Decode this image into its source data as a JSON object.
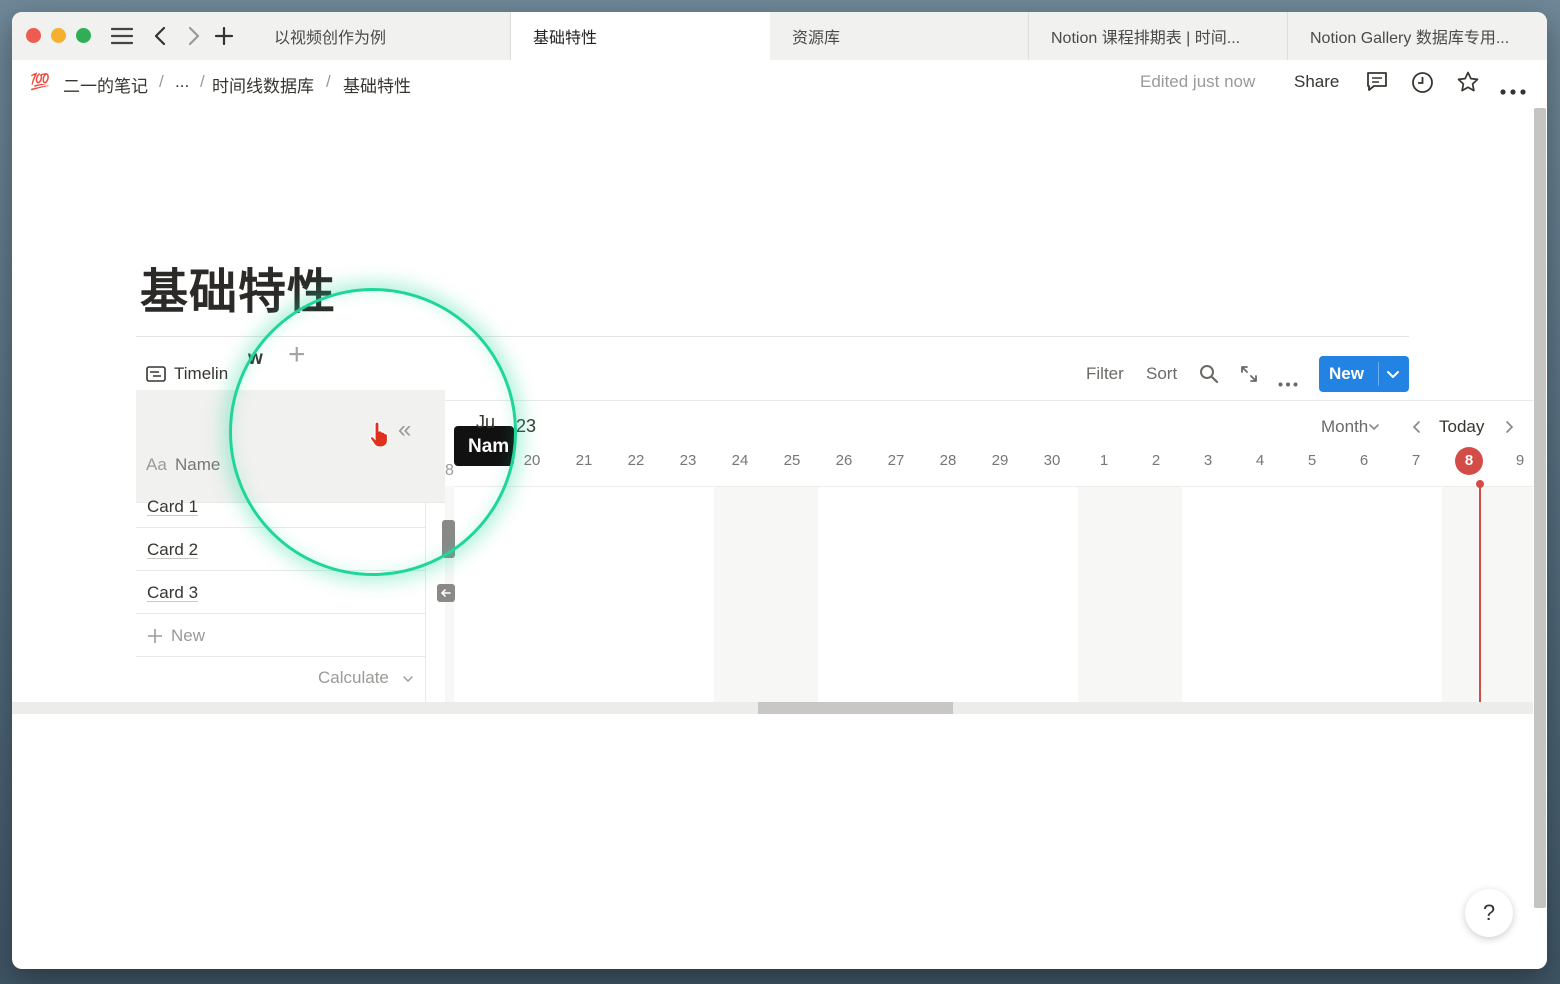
{
  "tabs": [
    {
      "label": "以视频创作为例"
    },
    {
      "label": "基础特性"
    },
    {
      "label": "资源库"
    },
    {
      "label": "Notion 课程排期表 | 时间..."
    },
    {
      "label": "Notion Gallery 数据库专用..."
    }
  ],
  "breadcrumb": {
    "icon": "💯",
    "items": [
      "二一的笔记",
      "...",
      "时间线数据库",
      "基础特性"
    ],
    "separator": "/"
  },
  "topbar": {
    "edited": "Edited just now",
    "share": "Share"
  },
  "page": {
    "title": "基础特性"
  },
  "view": {
    "tab_label": "Timelin",
    "tab_label_tail": "w",
    "add_symbol": "+",
    "filter": "Filter",
    "sort": "Sort",
    "new_button": "New"
  },
  "table": {
    "name_header_prefix": "Aa",
    "name_header": "Name",
    "rows": [
      "Card 1",
      "Card 2",
      "Card 3"
    ],
    "new_row": "New",
    "calculate": "Calculate"
  },
  "timeline": {
    "month_label": "Jun 23",
    "month_prefix_visible": "Ju",
    "month_suffix_visible": "23",
    "scale": "Month",
    "today": "Today",
    "left_partial_day": "8",
    "days": [
      "20",
      "21",
      "22",
      "23",
      "24",
      "25",
      "26",
      "27",
      "28",
      "29",
      "30",
      "1",
      "2",
      "3",
      "4",
      "5",
      "6",
      "7",
      "8",
      "9"
    ],
    "today_day": "8",
    "tooltip": "Nam"
  },
  "help": "?",
  "colors": {
    "accent": "#2383e2",
    "today_marker": "#d44c47",
    "lens_ring": "#1fd69a"
  }
}
